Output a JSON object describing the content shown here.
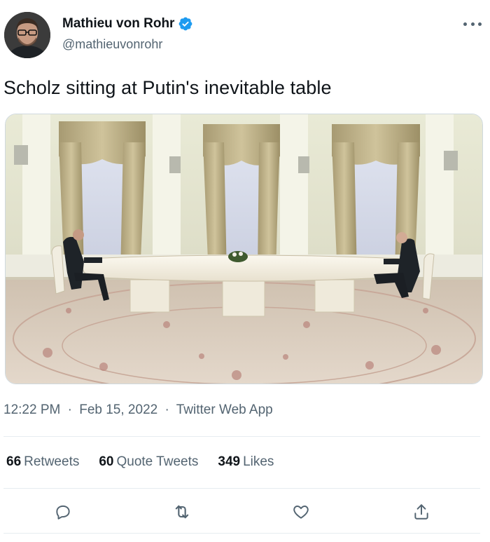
{
  "author": {
    "display_name": "Mathieu von Rohr",
    "handle": "@mathieuvonrohr",
    "verified": true
  },
  "tweet": {
    "text": "Scholz sitting at Putin's inevitable table",
    "time": "12:22 PM",
    "date": "Feb 15, 2022",
    "source": "Twitter Web App",
    "separator": "·"
  },
  "stats": {
    "retweets_count": "66",
    "retweets_label": "Retweets",
    "quotes_count": "60",
    "quotes_label": "Quote Tweets",
    "likes_count": "349",
    "likes_label": "Likes"
  },
  "icons": {
    "more": "more-icon",
    "reply": "reply-icon",
    "retweet": "retweet-icon",
    "like": "heart-icon",
    "share": "share-icon",
    "verified": "verified-badge-icon"
  },
  "colors": {
    "text": "#0f1419",
    "secondary": "#536471",
    "verified": "#1d9bf0",
    "divider": "#e6ecf0"
  }
}
